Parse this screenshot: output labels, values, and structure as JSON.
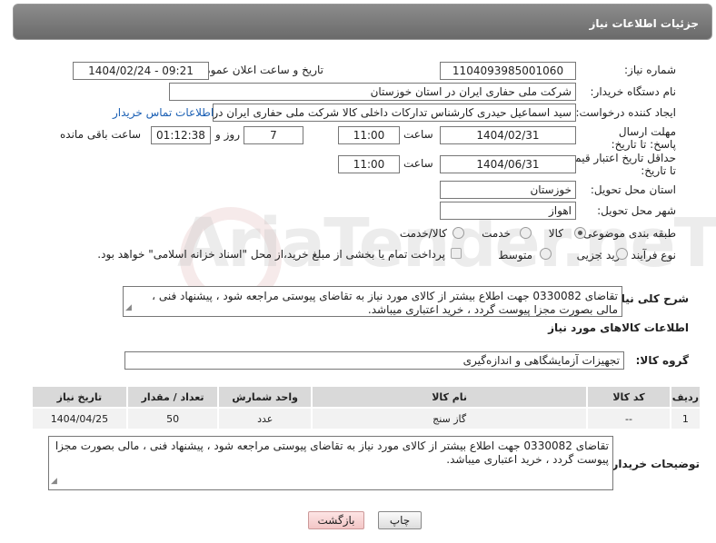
{
  "header": {
    "title": "جزئیات اطلاعات نیاز"
  },
  "form": {
    "need_number_label": "شماره نیاز:",
    "need_number": "1104093985001060",
    "announce_label": "تاریخ و ساعت اعلان عمومی:",
    "announce_value": "1404/02/24 - 09:21",
    "buyer_org_label": "نام دستگاه خریدار:",
    "buyer_org": "شرکت ملی حفاری ایران در استان خوزستان",
    "creator_label": "ایجاد کننده درخواست:",
    "creator": "سید اسماعیل حیدری کارشناس تدارکات داخلی کالا شرکت ملی حفاری ایران در",
    "contact_link": "اطلاعات تماس خریدار",
    "deadline_label": "مهلت ارسال پاسخ: تا تاریخ:",
    "deadline_date": "1404/02/31",
    "time_label": "ساعت",
    "deadline_time": "11:00",
    "days_value": "7",
    "days_label": "روز و",
    "remaining_time": "01:12:38",
    "remaining_label": "ساعت باقی مانده",
    "price_validity_label": "حداقل تاریخ اعتبار قیمت: تا تاریخ:",
    "price_validity_date": "1404/06/31",
    "price_validity_time": "11:00",
    "province_label": "استان محل تحویل:",
    "province": "خوزستان",
    "city_label": "شهر محل تحویل:",
    "city": "اهواز",
    "category_label": "طبقه بندی موضوعی:",
    "category_options": [
      "کالا",
      "خدمت",
      "کالا/خدمت"
    ],
    "category_selected": "کالا",
    "process_label": "نوع فرآیند خرید :",
    "process_options": [
      "جزیی",
      "متوسط"
    ],
    "payment_note": "پرداخت تمام یا بخشی از مبلغ خرید،از محل \"اسناد خزانه اسلامی\" خواهد بود.",
    "description_label": "شرح کلی نیاز:",
    "description": "تقاضای 0330082 جهت اطلاع بیشتر از کالای مورد نیاز به تقاضای پیوستی مراجعه شود ، پیشنهاد فنی ، مالی بصورت مجزا پیوست گردد ، خرید اعتباری میباشد."
  },
  "goods": {
    "section_title": "اطلاعات کالاهای مورد نیاز",
    "group_label": "گروه کالا:",
    "group_value": "تجهیزات آزمایشگاهی و اندازه‌گیری",
    "columns": [
      "ردیف",
      "کد کالا",
      "نام کالا",
      "واحد شمارش",
      "تعداد / مقدار",
      "تاریخ نیاز"
    ],
    "rows": [
      [
        "1",
        "--",
        "گاز سنج",
        "عدد",
        "50",
        "1404/04/25"
      ]
    ]
  },
  "buyer_notes": {
    "label": "توضیحات خریدار:",
    "text": "تقاضای 0330082 جهت اطلاع بیشتر از کالای مورد نیاز به تقاضای پیوستی مراجعه شود ، پیشنهاد فنی ، مالی بصورت مجزا پیوست گردد ، خرید اعتباری میباشد."
  },
  "buttons": {
    "print": "چاپ",
    "back": "بازگشت"
  },
  "watermark": "AriaTender.neT",
  "colors": {
    "link": "#1a5fb4",
    "header_bg": "#7a7a7a",
    "table_head": "#d9d9d9"
  }
}
